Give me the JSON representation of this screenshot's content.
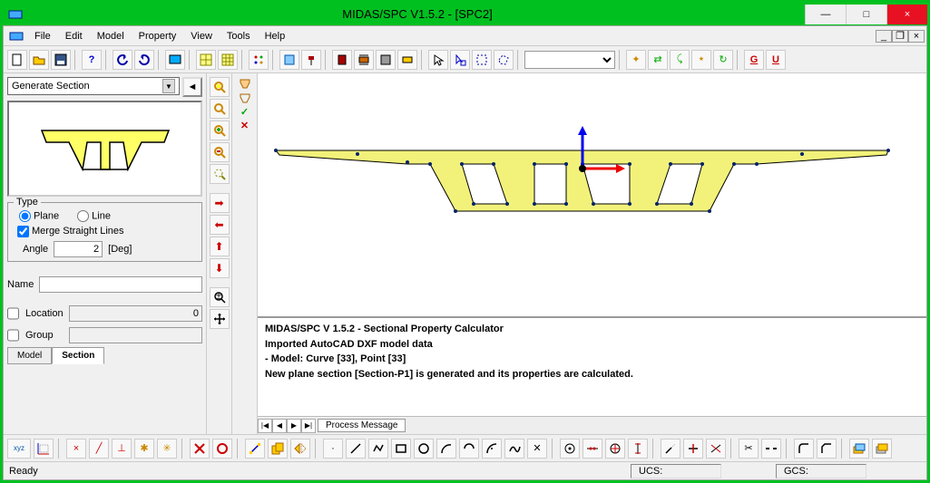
{
  "titlebar": {
    "title": "MIDAS/SPC V1.5.2 - [SPC2]"
  },
  "menu": [
    "File",
    "Edit",
    "Model",
    "Property",
    "View",
    "Tools",
    "Help"
  ],
  "windowbtns": {
    "min": "—",
    "max": "□",
    "close": "×",
    "mdimin": "_",
    "mdimax": "❐",
    "mdiclose": "×"
  },
  "left": {
    "combo": "Generate Section",
    "type_legend": "Type",
    "radio_plane": "Plane",
    "radio_line": "Line",
    "merge_label": "Merge Straight Lines",
    "angle_label": "Angle",
    "angle_value": "2",
    "angle_unit": "[Deg]",
    "name_label": "Name",
    "name_value": "",
    "location_label": "Location",
    "location_value": "0",
    "group_label": "Group",
    "group_value": "",
    "tab_model": "Model",
    "tab_section": "Section"
  },
  "console": {
    "l1": "MIDAS/SPC V 1.5.2 - Sectional Property Calculator",
    "l2": "Imported AutoCAD DXF model data",
    "l3": "- Model: Curve [33], Point [33]",
    "l4": "New plane section [Section-P1] is generated and its properties are calculated.",
    "tab": "Process Message"
  },
  "status": {
    "ready": "Ready",
    "ucs": "UCS:",
    "gcs": "GCS:"
  }
}
